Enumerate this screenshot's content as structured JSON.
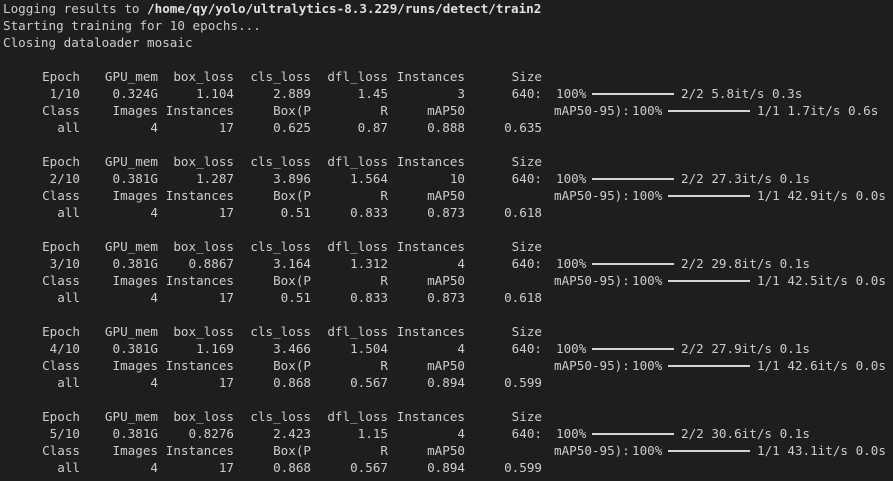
{
  "intro": {
    "line1_prefix": "Logging results to ",
    "line1_path": "/home/qy/yolo/ultralytics-8.3.229/runs/detect/train2",
    "line2": "Starting training for 10 epochs...",
    "line3": "Closing dataloader mosaic"
  },
  "headers": {
    "train": [
      "Epoch",
      "GPU_mem",
      "box_loss",
      "cls_loss",
      "dfl_loss",
      "Instances",
      "Size"
    ],
    "val": [
      "Class",
      "Images",
      "Instances",
      "Box(P",
      "R",
      "mAP50",
      "mAP50-95):"
    ]
  },
  "epochs": [
    {
      "train": [
        "1/10",
        "0.324G",
        "1.104",
        "2.889",
        "1.45",
        "3",
        "640:"
      ],
      "train_pct": "100%",
      "train_rate": "2/2 5.8it/s 0.3s",
      "val_pct": "100%",
      "val_rate": "1/1 1.7it/s 0.6s",
      "result": [
        "all",
        "4",
        "17",
        "0.625",
        "0.87",
        "0.888",
        "0.635"
      ]
    },
    {
      "train": [
        "2/10",
        "0.381G",
        "1.287",
        "3.896",
        "1.564",
        "10",
        "640:"
      ],
      "train_pct": "100%",
      "train_rate": "2/2 27.3it/s 0.1s",
      "val_pct": "100%",
      "val_rate": "1/1 42.9it/s 0.0s",
      "result": [
        "all",
        "4",
        "17",
        "0.51",
        "0.833",
        "0.873",
        "0.618"
      ]
    },
    {
      "train": [
        "3/10",
        "0.381G",
        "0.8867",
        "3.164",
        "1.312",
        "4",
        "640:"
      ],
      "train_pct": "100%",
      "train_rate": "2/2 29.8it/s 0.1s",
      "val_pct": "100%",
      "val_rate": "1/1 42.5it/s 0.0s",
      "result": [
        "all",
        "4",
        "17",
        "0.51",
        "0.833",
        "0.873",
        "0.618"
      ]
    },
    {
      "train": [
        "4/10",
        "0.381G",
        "1.169",
        "3.466",
        "1.504",
        "4",
        "640:"
      ],
      "train_pct": "100%",
      "train_rate": "2/2 27.9it/s 0.1s",
      "val_pct": "100%",
      "val_rate": "1/1 42.6it/s 0.0s",
      "result": [
        "all",
        "4",
        "17",
        "0.868",
        "0.567",
        "0.894",
        "0.599"
      ]
    },
    {
      "train": [
        "5/10",
        "0.381G",
        "0.8276",
        "2.423",
        "1.15",
        "4",
        "640:"
      ],
      "train_pct": "100%",
      "train_rate": "2/2 30.6it/s 0.1s",
      "val_pct": "100%",
      "val_rate": "1/1 43.1it/s 0.0s",
      "result": [
        "all",
        "4",
        "17",
        "0.868",
        "0.567",
        "0.894",
        "0.599"
      ]
    }
  ],
  "progress": {
    "train_fraction": 1.0,
    "val_fraction": 1.0
  }
}
